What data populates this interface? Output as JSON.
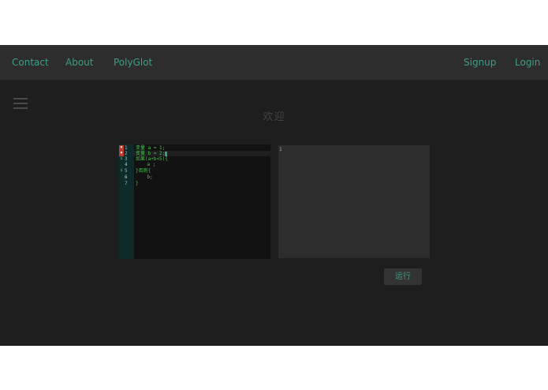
{
  "navbar": {
    "left": [
      {
        "label": "Contact"
      },
      {
        "label": "About"
      },
      {
        "label": "PolyGlot"
      }
    ],
    "right": [
      {
        "label": "Signup"
      },
      {
        "label": "Login"
      }
    ]
  },
  "menu": {
    "icon": "hamburger-menu-icon"
  },
  "page": {
    "title": "欢迎"
  },
  "editor": {
    "lines": [
      {
        "marker": "✖",
        "marker_type": "error",
        "number": "1",
        "code": "变量 a = 1;"
      },
      {
        "marker": "✖",
        "marker_type": "error",
        "number": "2",
        "code": "变量 b = 2;"
      },
      {
        "marker": "i",
        "marker_type": "info",
        "number": "3 -",
        "code": "如果(a+b<5){"
      },
      {
        "marker": "",
        "marker_type": "",
        "number": "4",
        "code": "    a ;"
      },
      {
        "marker": "i",
        "marker_type": "info",
        "number": "5 -",
        "code": "}否则{"
      },
      {
        "marker": "",
        "marker_type": "",
        "number": "6",
        "code": "    b;"
      },
      {
        "marker": "",
        "marker_type": "",
        "number": "7",
        "code": "}"
      }
    ]
  },
  "output": {
    "text": "1"
  },
  "run_button": {
    "label": "运行"
  },
  "colors": {
    "accent": "#3f9c86",
    "code_text": "#40c74c",
    "background": "#1e1e1e",
    "navbar": "#2d2d2d",
    "error_marker": "#c0392b"
  }
}
